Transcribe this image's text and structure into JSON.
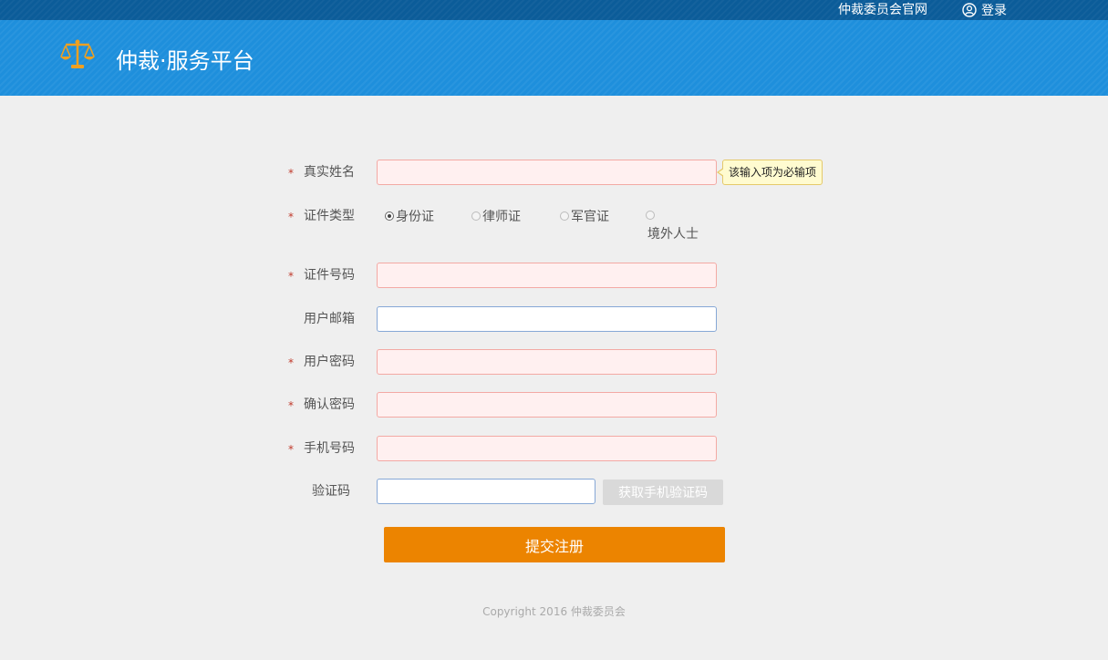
{
  "topbar": {
    "official_site_link": "仲裁委员会官网",
    "login_link": "登录"
  },
  "header": {
    "site_title": "仲裁·服务平台"
  },
  "form": {
    "required_mark": "*",
    "fields": {
      "real_name": {
        "label": "真实姓名",
        "value": "",
        "required": true
      },
      "id_type": {
        "label": "证件类型",
        "required": true,
        "options": [
          "身份证",
          "律师证",
          "军官证",
          "境外人士"
        ],
        "selected": "身份证"
      },
      "id_number": {
        "label": "证件号码",
        "value": "",
        "required": true
      },
      "email": {
        "label": "用户邮箱",
        "value": "",
        "required": false
      },
      "password": {
        "label": "用户密码",
        "value": "",
        "required": true
      },
      "confirm_password": {
        "label": "确认密码",
        "value": "",
        "required": true
      },
      "phone": {
        "label": "手机号码",
        "value": "",
        "required": true
      },
      "verify_code": {
        "label": "验证码",
        "value": "",
        "required": false
      }
    },
    "validation_tooltip": "该输入项为必输项",
    "get_sms_code_button": "获取手机验证码",
    "submit_button": "提交注册"
  },
  "footer": {
    "copyright": "Copyright 2016 仲裁委员会"
  },
  "colors": {
    "topbar_bg": "#0b5c99",
    "header_bg": "#1e8fdc",
    "submit_bg": "#ec8400",
    "required_star": "#c0392b",
    "invalid_input_border": "#f3a9a4",
    "tooltip_bg": "#fffbd0"
  },
  "icons": {
    "logo": "scales-of-justice-icon",
    "login": "user-circle-icon"
  }
}
